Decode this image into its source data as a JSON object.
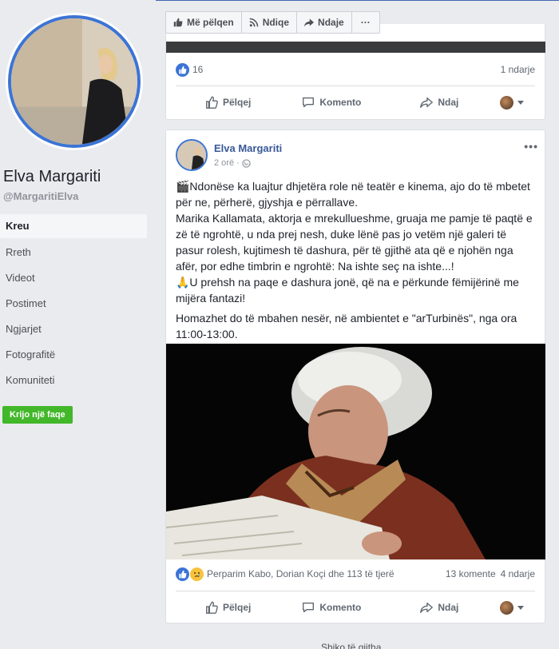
{
  "page": {
    "name": "Elva Margariti",
    "handle": "@MargaritiElva"
  },
  "sidebar": {
    "items": [
      {
        "label": "Kreu",
        "active": true
      },
      {
        "label": "Rreth"
      },
      {
        "label": "Videot"
      },
      {
        "label": "Postimet"
      },
      {
        "label": "Ngjarjet"
      },
      {
        "label": "Fotografitë"
      },
      {
        "label": "Komuniteti"
      }
    ],
    "create_label": "Krijo një faqe"
  },
  "topbar": {
    "like_label": "Më pëlqen",
    "follow_label": "Ndiqe",
    "share_label": "Ndaje",
    "more_label": "···"
  },
  "post1": {
    "likes": "16",
    "shares": "1 ndarje"
  },
  "actions": {
    "like": "Pëlqej",
    "comment": "Komento",
    "share": "Ndaj"
  },
  "post2": {
    "author": "Elva Margariti",
    "time": "2 orë ·",
    "paragraphs": [
      "🎬Ndonëse ka luajtur dhjetëra role në teatër e kinema, ajo do të mbetet për ne, përherë, gjyshja e përrallave.\nMarika Kallamata, aktorja e mrekullueshme, gruaja me pamje të paqtë e zë të ngrohtë, u nda prej nesh, duke lënë pas jo vetëm një galeri të pasur rolesh, kujtimesh të dashura, për të gjithë ata që e njohën nga afër, por edhe timbrin e ngrohtë: Na ishte seç na ishte...!\n🙏U prehsh na paqe e dashura jonë, që na e përkunde fëmijërinë me mijëra fantazi!",
      "Homazhet do të mbahen nesër, në ambientet e \"arTurbinës\", nga ora 11:00-13:00."
    ],
    "reactors": "Perparim Kabo, Dorian Koçi dhe 113 të tjerë",
    "comments": "13 komente",
    "shares": "4 ndarje"
  },
  "footer": {
    "see_all": "Shiko të gjitha"
  },
  "colors": {
    "accent": "#3b74d6",
    "link": "#385898",
    "create_button": "#42b72a"
  }
}
